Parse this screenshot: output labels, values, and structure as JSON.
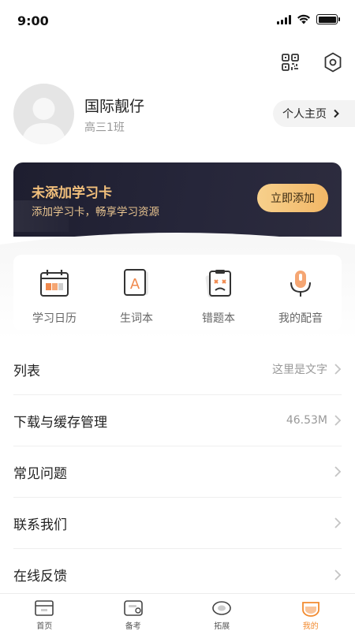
{
  "status_bar": {
    "time": "9:00"
  },
  "top_icons": [
    "qr-code-icon",
    "settings-icon"
  ],
  "profile": {
    "name": "国际靓仔",
    "class": "高三1班",
    "homepage_label": "个人主页"
  },
  "study_card": {
    "title": "未添加学习卡",
    "subtitle": "添加学习卡，畅享学习资源",
    "button": "立即添加"
  },
  "quick_actions": [
    {
      "label": "学习日历",
      "icon": "calendar-icon"
    },
    {
      "label": "生词本",
      "icon": "word-book-icon"
    },
    {
      "label": "错题本",
      "icon": "wrong-questions-icon"
    },
    {
      "label": "我的配音",
      "icon": "microphone-icon"
    }
  ],
  "menu": [
    {
      "label": "列表",
      "value": "这里是文字"
    },
    {
      "label": "下载与缓存管理",
      "value": "46.53M"
    },
    {
      "label": "常见问题",
      "value": ""
    },
    {
      "label": "联系我们",
      "value": ""
    },
    {
      "label": "在线反馈",
      "value": ""
    }
  ],
  "tabs": [
    {
      "label": "首页",
      "icon": "home-icon",
      "active": false
    },
    {
      "label": "备考",
      "icon": "exam-prep-icon",
      "active": false
    },
    {
      "label": "拓展",
      "icon": "expand-icon",
      "active": false
    },
    {
      "label": "我的",
      "icon": "profile-icon",
      "active": true
    }
  ],
  "colors": {
    "accent": "#f28a2e",
    "card_bg": "#1e1e2f",
    "card_title": "#f3c07c",
    "card_button": "#f4c071"
  }
}
